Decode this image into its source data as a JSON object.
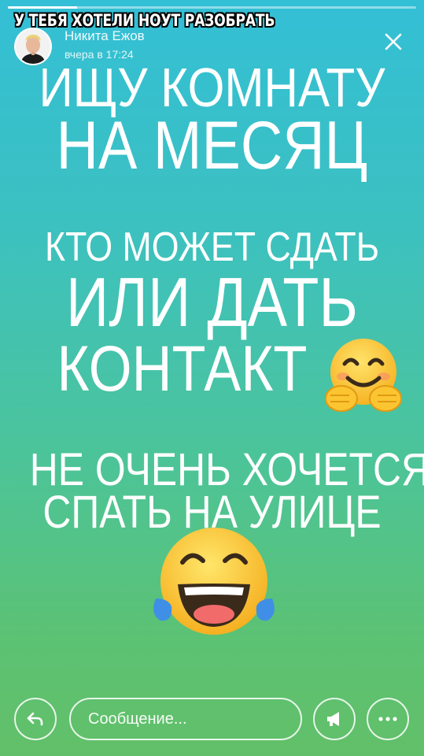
{
  "progress": {
    "fraction": 0.17
  },
  "overlay_caption": "У ТЕБЯ ХОТЕЛИ НОУТ РАЗОБРАТЬ",
  "author": {
    "name": "Никита Ежов",
    "time": "вчера в 17:24"
  },
  "story": {
    "lines": [
      "ИЩУ КОМНАТУ",
      "НА МЕСЯЦ",
      "КТО МОЖЕТ СДАТЬ",
      "ИЛИ ДАТЬ",
      "КОНТАКТ",
      "НЕ ОЧЕНЬ ХОЧЕТСЯ",
      "СПАТЬ НА УЛИЦЕ"
    ],
    "emojis": [
      "hugging-face-emoji",
      "tears-of-joy-emoji"
    ]
  },
  "footer": {
    "message_placeholder": "Сообщение..."
  },
  "icons": [
    "close-icon",
    "reply-icon",
    "megaphone-icon",
    "more-icon"
  ],
  "colors": {
    "gradient_top": "#33bfd6",
    "gradient_bottom": "#62bf69",
    "text": "#ffffff"
  }
}
